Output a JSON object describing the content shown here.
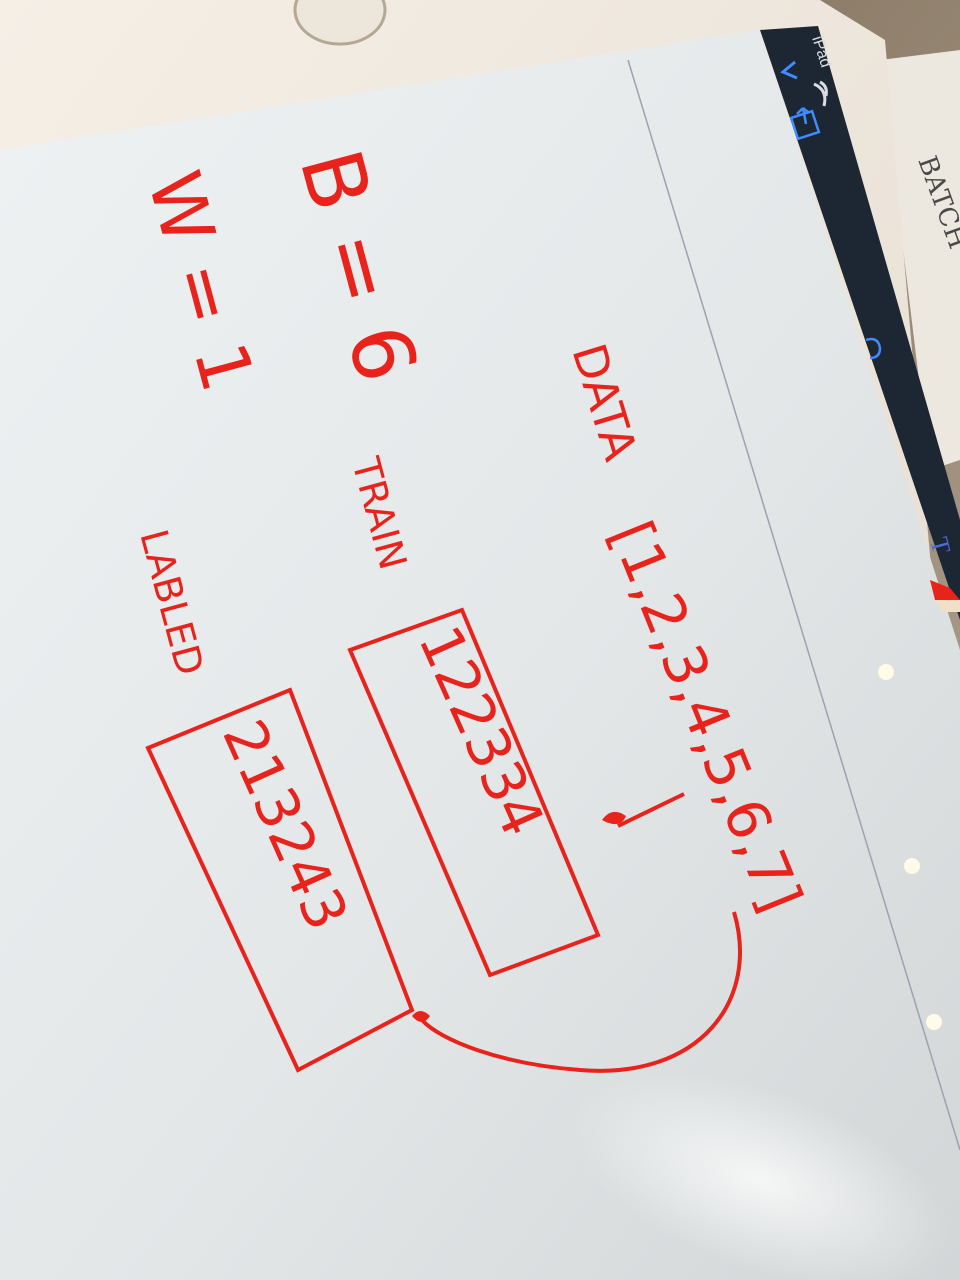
{
  "device": {
    "name": "iPad"
  },
  "toolbar": {
    "back_icon": "chevron-left-icon",
    "share_icon": "share-icon",
    "undo_icon": "undo-icon",
    "text_tool_label": "T",
    "pencil_icon": "pencil-icon"
  },
  "background_paper": {
    "label": "BATCH"
  },
  "note": {
    "ink_color": "#e8231c",
    "b_equation": "B = 6",
    "w_equation": "W = 1",
    "data_label": "DATA",
    "data_array": "[1,2,3,4,5,6,7]",
    "train_label": "TRAIN",
    "train_values": "122334",
    "labeled_label": "LABLED",
    "labeled_values": "213243"
  }
}
